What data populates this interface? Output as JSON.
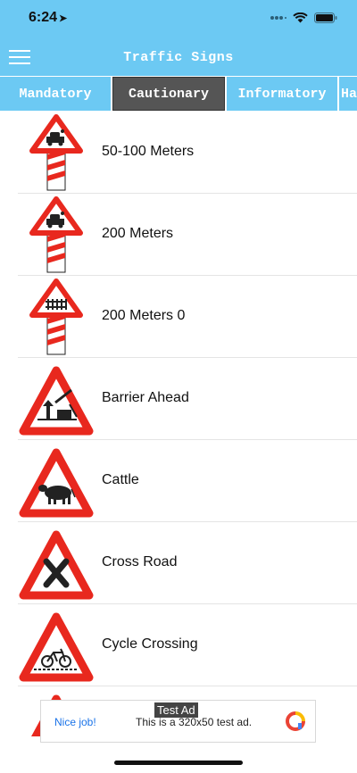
{
  "status_bar": {
    "time": "6:24",
    "location_icon": "location-arrow-icon"
  },
  "app_bar": {
    "title": "Traffic Signs",
    "menu_icon": "hamburger-menu-icon"
  },
  "tabs": [
    {
      "label": "Mandatory",
      "active": false
    },
    {
      "label": "Cautionary",
      "active": true
    },
    {
      "label": "Informatory",
      "active": false
    },
    {
      "label": "Ha",
      "active": false
    }
  ],
  "signs": [
    {
      "label": "50-100 Meters",
      "icon": "railway-crossing-50-100m-icon"
    },
    {
      "label": "200 Meters",
      "icon": "railway-crossing-200m-icon"
    },
    {
      "label": "200 Meters 0",
      "icon": "gated-railway-crossing-200m-icon"
    },
    {
      "label": "Barrier Ahead",
      "icon": "barrier-ahead-icon"
    },
    {
      "label": "Cattle",
      "icon": "cattle-icon"
    },
    {
      "label": "Cross Road",
      "icon": "cross-road-icon"
    },
    {
      "label": "Cycle Crossing",
      "icon": "cycle-crossing-icon"
    }
  ],
  "ad": {
    "tag": "Test Ad",
    "nice": "Nice job!",
    "text": "This is a 320x50 test ad."
  },
  "colors": {
    "accent": "#6cc9f3",
    "active_tab": "#555555",
    "sign_red": "#e8281e"
  }
}
